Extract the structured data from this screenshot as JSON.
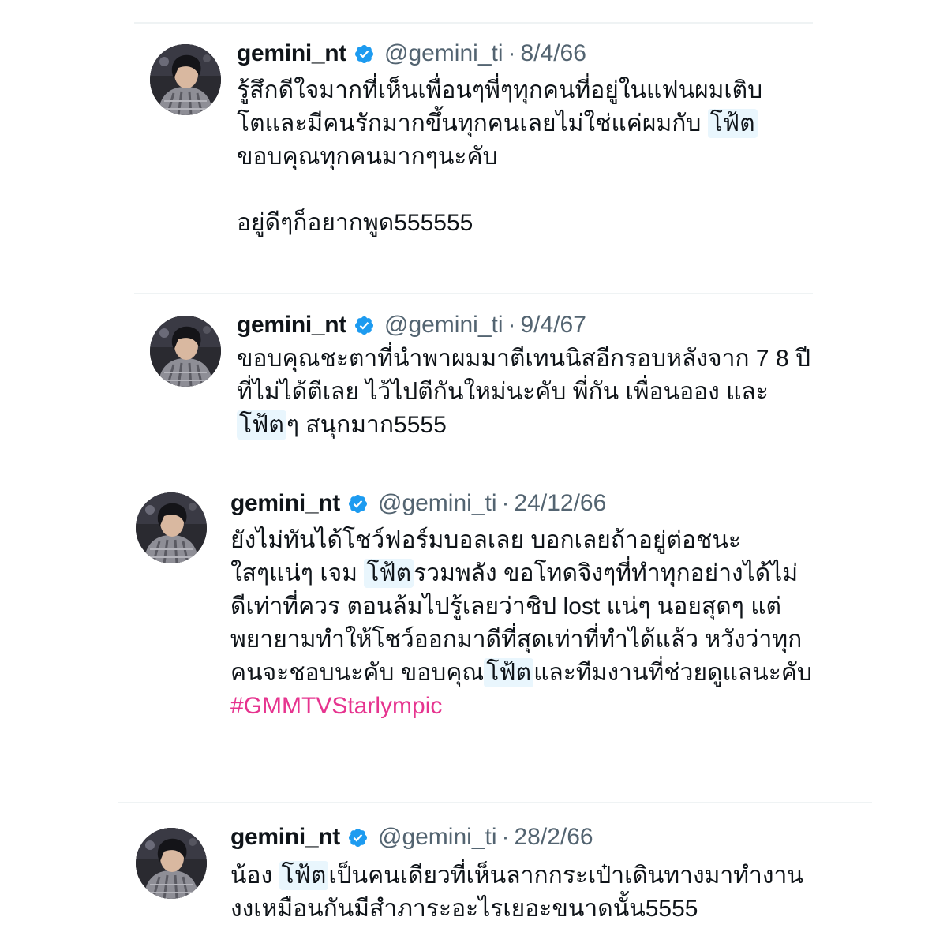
{
  "colors": {
    "highlight": "#e9f6fd",
    "hashtag": "#e6348f",
    "verified": "#1d9bf0",
    "secondary_text": "#536471"
  },
  "tweets": [
    {
      "display_name": "gemini_nt",
      "handle": "@gemini_ti",
      "separator": "·",
      "date": "8/4/66",
      "verified_icon": "verified-badge-icon",
      "lines": [
        [
          {
            "t": "รู้สึกดีใจมากที่เห็นเพื่อนๆพี่ๆทุกคนที่อยู่ในแฟนผมเติบ"
          }
        ],
        [
          {
            "t": "โตและมีคนรักมากขึ้นทุกคนเลยไม่ใช่แค่ผมกับ "
          },
          {
            "t": "โฟ้ต",
            "hl": true
          }
        ],
        [
          {
            "t": "ขอบคุณทุกคนมากๆนะคับ"
          }
        ],
        [],
        [
          {
            "t": "อยู่ดีๆก็อยากพูด555555"
          }
        ]
      ]
    },
    {
      "display_name": "gemini_nt",
      "handle": "@gemini_ti",
      "separator": "·",
      "date": "9/4/67",
      "verified_icon": "verified-badge-icon",
      "lines": [
        [
          {
            "t": "ขอบคุณชะตาที่นำพาผมมาตีเทนนิสอีกรอบหลังจาก 7 8 ปี"
          }
        ],
        [
          {
            "t": "ที่ไม่ได้ตีเลย ไว้ไปตีกันใหม่นะคับ พี่กัน เพื่อนออง และ"
          }
        ],
        [
          {
            "t": "โฟ้ต",
            "hl": true
          },
          {
            "t": "ๆ สนุกมาก5555"
          }
        ]
      ]
    },
    {
      "display_name": "gemini_nt",
      "handle": "@gemini_ti",
      "separator": "·",
      "date": "24/12/66",
      "verified_icon": "verified-badge-icon",
      "lines": [
        [
          {
            "t": "ยังไม่ทันได้โชว์ฟอร์มบอลเลย บอกเลยถ้าอยู่ต่อชนะ"
          }
        ],
        [
          {
            "t": "ใสๆแน่ๆ เจม "
          },
          {
            "t": "โฟ้ต",
            "hl": true
          },
          {
            "t": "รวมพลัง ขอโทดจิงๆที่ทำทุกอย่างได้ไม่"
          }
        ],
        [
          {
            "t": "ดีเท่าที่ควร ตอนล้มไปรู้เลยว่าชิป lost แน่ๆ นอยสุดๆ แต่"
          }
        ],
        [
          {
            "t": "พยายามทำให้โชว์ออกมาดีที่สุดเท่าที่ทำได้แล้ว หวังว่าทุก"
          }
        ],
        [
          {
            "t": "คนจะชอบนะคับ ขอบคุณ"
          },
          {
            "t": "โฟ้ต",
            "hl": true
          },
          {
            "t": "และทีมงานที่ช่วยดูแลนะคับ"
          }
        ],
        [
          {
            "t": "#GMMTVStarlympic",
            "hashtag": true
          }
        ]
      ]
    },
    {
      "display_name": "gemini_nt",
      "handle": "@gemini_ti",
      "separator": "·",
      "date": "28/2/66",
      "verified_icon": "verified-badge-icon",
      "lines": [
        [
          {
            "t": "น้อง "
          },
          {
            "t": "โฟ้ต",
            "hl": true
          },
          {
            "t": "เป็นคนเดียวที่เห็นลากกระเป๋าเดินทางมาทำงาน"
          }
        ],
        [
          {
            "t": "งงเหมือนกันมีสำภาระอะไรเยอะขนาดนั้น5555"
          }
        ]
      ]
    }
  ]
}
